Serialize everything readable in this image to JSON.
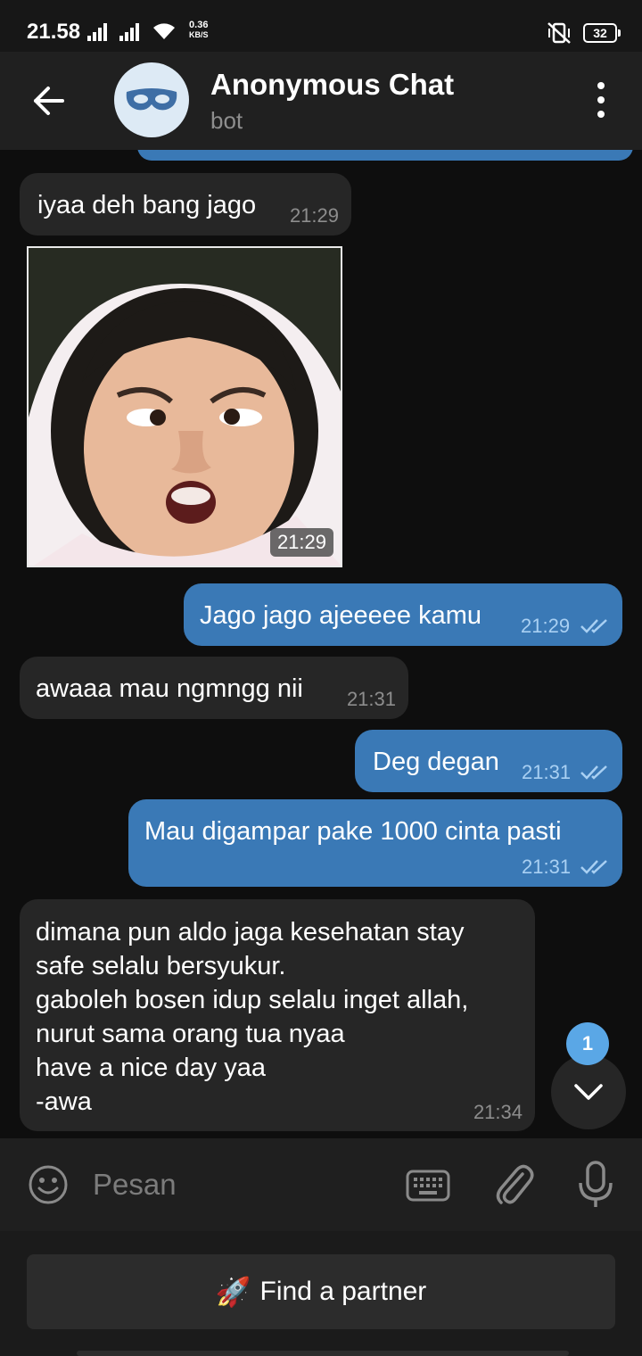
{
  "status_bar": {
    "time": "21.58",
    "speed_value": "0.36",
    "speed_unit": "KB/S",
    "battery": "32"
  },
  "header": {
    "title": "Anonymous Chat",
    "subtitle": "bot"
  },
  "messages": [
    {
      "direction": "in",
      "text": "iyaa deh bang jago",
      "time": "21:29"
    },
    {
      "direction": "in",
      "type": "sticker",
      "time": "21:29"
    },
    {
      "direction": "out",
      "text": "Jago jago ajeeeee kamu",
      "time": "21:29",
      "read": true
    },
    {
      "direction": "in",
      "text": "awaaa mau ngmngg nii",
      "time": "21:31"
    },
    {
      "direction": "out",
      "text": "Deg degan",
      "time": "21:31",
      "read": true
    },
    {
      "direction": "out",
      "text": "Mau digampar pake 1000 cinta pasti",
      "time": "21:31",
      "read": true
    },
    {
      "direction": "in",
      "text": "dimana pun aldo jaga kesehatan stay\nsafe selalu bersyukur.\ngaboleh bosen idup selalu inget allah,\nnurut sama orang tua nyaa\nhave a nice day yaa\n-awa",
      "time": "21:34"
    }
  ],
  "scroll_badge": "1",
  "input": {
    "placeholder": "Pesan"
  },
  "bot_button": {
    "label": "Find a partner",
    "emoji": "🚀"
  },
  "colors": {
    "outgoing_bubble": "#3a79b6",
    "incoming_bubble": "#262626",
    "background": "#0e0e0e",
    "accent": "#5aa7e6"
  }
}
